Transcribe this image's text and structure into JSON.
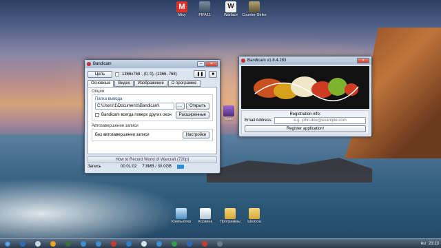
{
  "desktop": {
    "top_icons": [
      {
        "label": "Mixy",
        "color": "#d9342b"
      },
      {
        "label": "FIFA11",
        "color": "#5a6d80"
      },
      {
        "label": "Warface",
        "color": "#e9e9e9"
      },
      {
        "label": "Counter-Strike",
        "color": "#9a8f62"
      }
    ],
    "side_icon": {
      "label": "Кряк",
      "color": "#7a4ca2"
    },
    "bottom_icons": [
      {
        "label": "Компьютер",
        "color": "#7fb3de"
      },
      {
        "label": "Корзина",
        "color": "#e8eef2"
      },
      {
        "label": "Программы",
        "color": "#e6c35a"
      },
      {
        "label": "Шелуха",
        "color": "#e6c35a"
      }
    ]
  },
  "bandicam": {
    "title": "Bandicam",
    "target_button": "Цель",
    "resolution": "1366x768 - (0, 0), (1366, 768)",
    "tabs": [
      "Основные",
      "Видео",
      "Изображение",
      "О программе"
    ],
    "options_group": "Опции",
    "output_label": "Папка вывода",
    "output_path": "C:\\Users\\1\\Documents\\Bandicam\\",
    "browse_button": "...",
    "open_button": "Открыть",
    "topmost_checkbox": "Bandicam всегда поверх других окон",
    "advanced_button": "Расширенные",
    "autostop_group": "Автозавершение записи",
    "autostop_value": "Без автозавершения записи",
    "settings_button": "Настройки",
    "ad_text": "How to Record World of Warcraft (720p)",
    "status_label": "Запись",
    "status_time": "00:01:02",
    "status_size": "7.8MB / 30.0GB"
  },
  "register": {
    "title": "Bandicam v1.8.4.283",
    "info_label": "Registration info:",
    "email_label": "Email Address:",
    "email_placeholder": "e.g. john.doe@example.com",
    "register_button": "Register application!"
  },
  "taskbar": {
    "clock_time": "23:13",
    "lang": "RU",
    "items": [
      "#2d6bb8",
      "#c9d6e4",
      "#f0a21c",
      "#3b6f3b",
      "#3a8fd0",
      "#3a8fd0",
      "#c93b2f",
      "#2b7fc7",
      "#d7e4ef",
      "#3a8fd0",
      "#2d9f4a",
      "#2d6bb8",
      "#c93b2f",
      "#6d7c8c"
    ]
  }
}
